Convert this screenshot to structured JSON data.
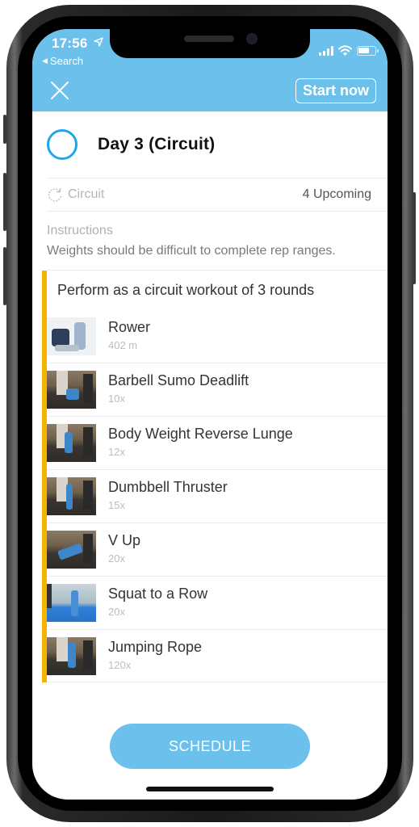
{
  "status_bar": {
    "time": "17:56",
    "back_label": "Search"
  },
  "header": {
    "close_icon": "close-icon",
    "start_label": "Start now",
    "accent_color": "#6bc1ec"
  },
  "workout": {
    "title": "Day 3 (Circuit)",
    "type_label": "Circuit",
    "upcoming_label": "4 Upcoming",
    "instructions_label": "Instructions",
    "instructions_text": "Weights should be difficult to complete rep ranges."
  },
  "circuit": {
    "title": "Perform as a circuit workout of 3 rounds",
    "accent_color": "#f5b400",
    "exercises": [
      {
        "name": "Rower",
        "reps": "402 m"
      },
      {
        "name": "Barbell Sumo Deadlift",
        "reps": "10x"
      },
      {
        "name": "Body Weight Reverse Lunge",
        "reps": "12x"
      },
      {
        "name": "Dumbbell Thruster",
        "reps": "15x"
      },
      {
        "name": "V Up",
        "reps": "20x"
      },
      {
        "name": "Squat to a Row",
        "reps": "20x"
      },
      {
        "name": "Jumping Rope",
        "reps": "120x"
      }
    ]
  },
  "footer": {
    "schedule_label": "SCHEDULE"
  }
}
